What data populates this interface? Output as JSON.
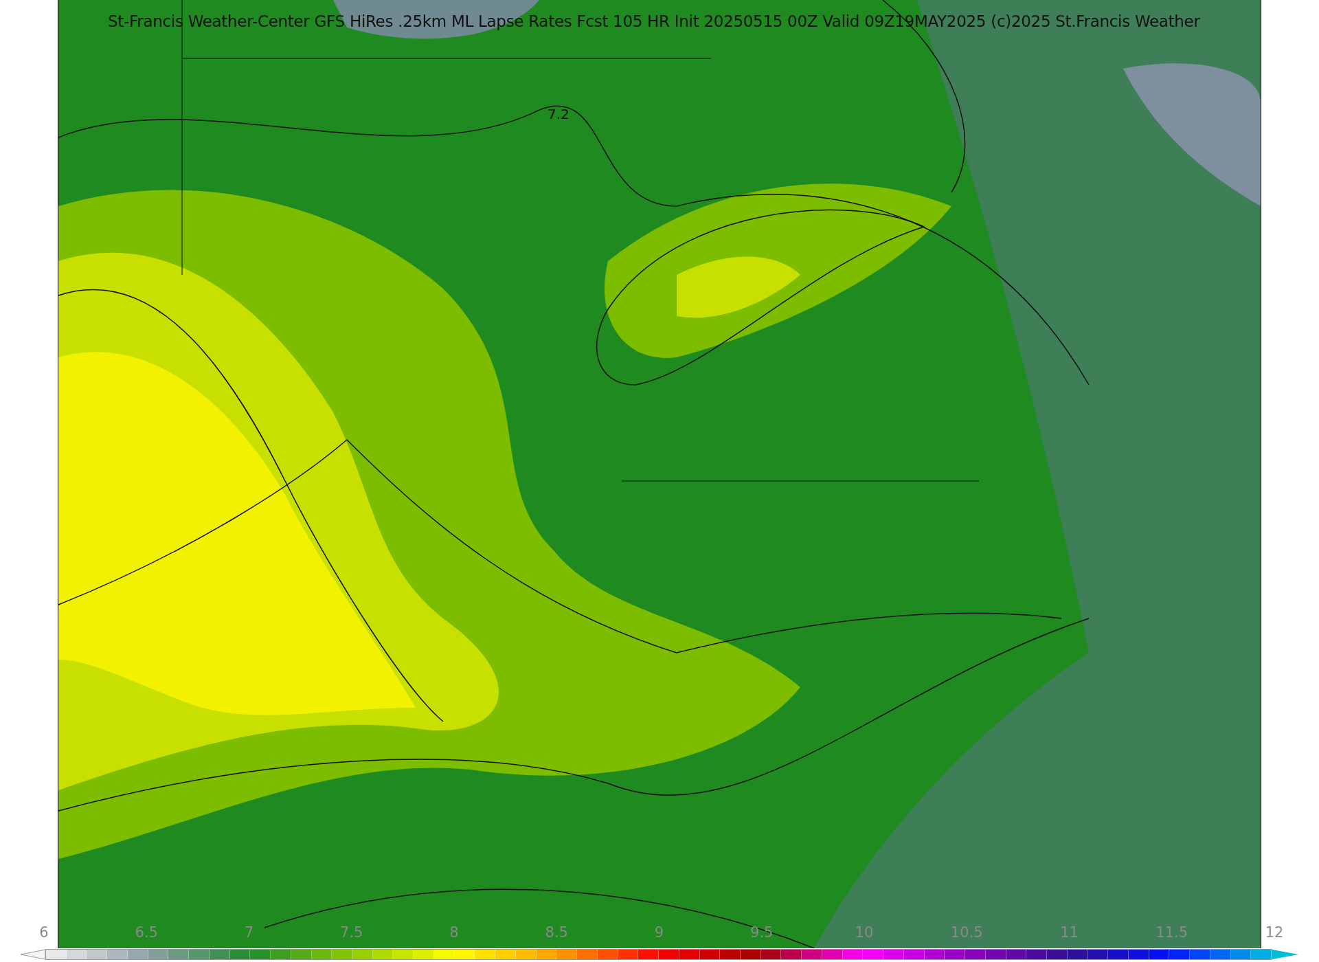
{
  "title": "St-Francis Weather-Center GFS HiRes .25km ML Lapse Rates  Fcst 105 HR Init 20250515 00Z  Valid 09Z19MAY2025    (c)2025 St.Francis Weather",
  "contour_labels": [
    "7.2"
  ],
  "colorbar": {
    "ticks": [
      "6",
      "6.5",
      "7",
      "7.5",
      "8",
      "8.5",
      "9",
      "9.5",
      "10",
      "10.5",
      "11",
      "11.5",
      "12"
    ]
  }
}
